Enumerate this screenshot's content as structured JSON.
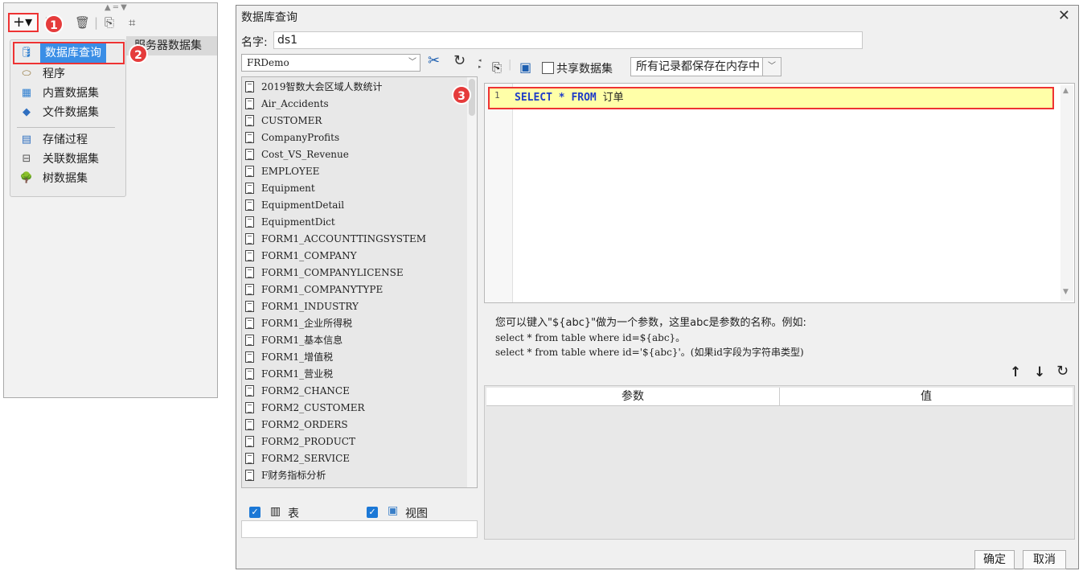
{
  "left_panel": {
    "toolbar": {
      "add_label": "+▾"
    },
    "menu_items": [
      {
        "label": "数据库查询",
        "icon": "database-icon"
      },
      {
        "label": "程序",
        "icon": "program-icon"
      },
      {
        "label": "内置数据集",
        "icon": "builtin-dataset-icon"
      },
      {
        "label": "文件数据集",
        "icon": "file-dataset-icon"
      },
      {
        "label": "存储过程",
        "icon": "stored-procedure-icon"
      },
      {
        "label": "关联数据集",
        "icon": "relation-dataset-icon"
      },
      {
        "label": "树数据集",
        "icon": "tree-dataset-icon"
      }
    ],
    "server_dataset_tab": "服务器数据集"
  },
  "badges": [
    "1",
    "2",
    "3"
  ],
  "dialog": {
    "title": "数据库查询",
    "name_label": "名字:",
    "name_value": "ds1",
    "connection": "FRDemo",
    "tables": [
      "2019智数大会区域人数统计",
      "Air_Accidents",
      "CUSTOMER",
      "CompanyProfits",
      "Cost_VS_Revenue",
      "EMPLOYEE",
      "Equipment",
      "EquipmentDetail",
      "EquipmentDict",
      "FORM1_ACCOUNTTINGSYSTEM",
      "FORM1_COMPANY",
      "FORM1_COMPANYLICENSE",
      "FORM1_COMPANYTYPE",
      "FORM1_INDUSTRY",
      "FORM1_企业所得税",
      "FORM1_基本信息",
      "FORM1_增值税",
      "FORM1_营业税",
      "FORM2_CHANCE",
      "FORM2_CUSTOMER",
      "FORM2_ORDERS",
      "FORM2_PRODUCT",
      "FORM2_SERVICE",
      "F财务指标分析"
    ],
    "filter_table_label": "表",
    "filter_view_label": "视图",
    "share_label": "共享数据集",
    "cache_option": "所有记录都保存在内存中",
    "sql": {
      "line_number": "1",
      "keyword1": "SELECT",
      "star": "*",
      "keyword2": "FROM",
      "table": "订单"
    },
    "hint": {
      "line1": "您可以键入\"${abc}\"做为一个参数，这里abc是参数的名称。例如:",
      "line2": "select * from table where id=${abc}。",
      "line3": "select * from table where id='${abc}'。(如果id字段为字符串类型)"
    },
    "param_columns": [
      "参数",
      "值"
    ],
    "ok_label": "确定",
    "cancel_label": "取消"
  }
}
